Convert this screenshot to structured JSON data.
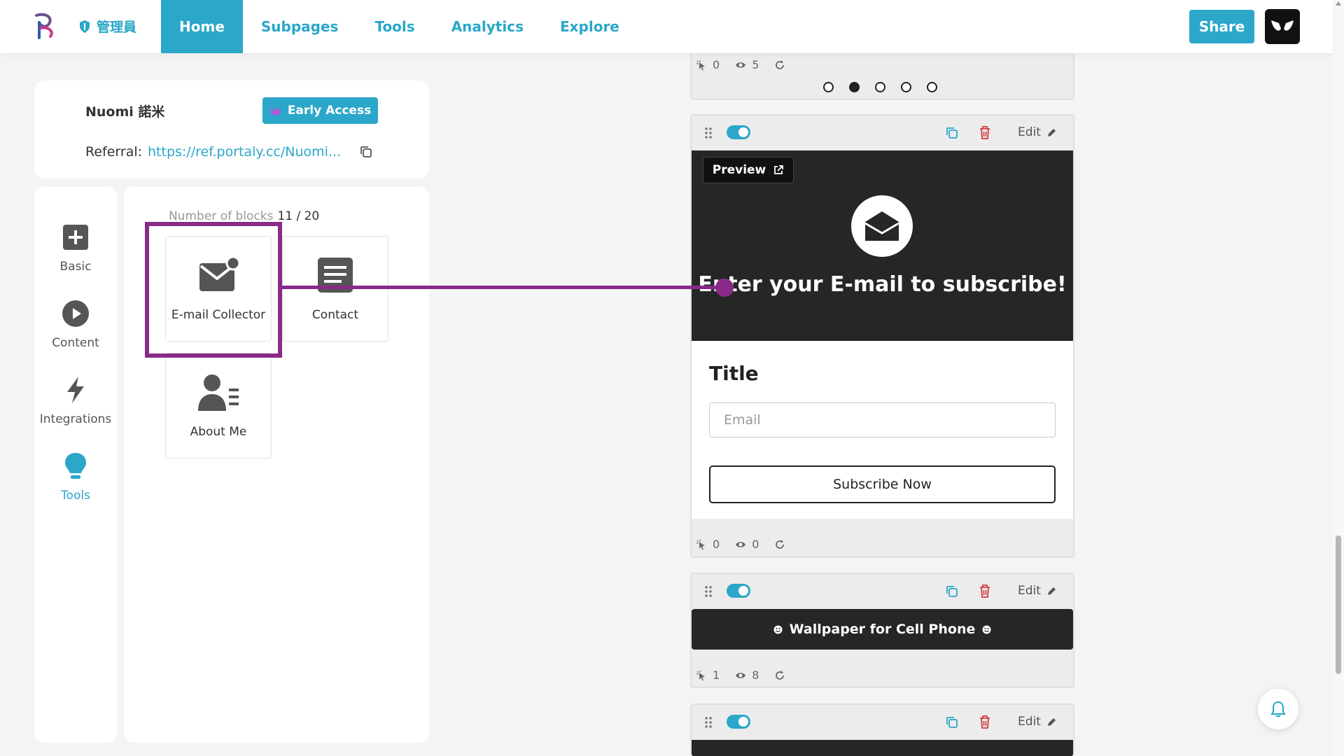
{
  "header": {
    "admin_label": "管理員",
    "nav": [
      {
        "label": "Home",
        "active": true
      },
      {
        "label": "Subpages",
        "active": false
      },
      {
        "label": "Tools",
        "active": false
      },
      {
        "label": "Analytics",
        "active": false
      },
      {
        "label": "Explore",
        "active": false
      }
    ],
    "share_label": "Share"
  },
  "profile": {
    "name": "Nuomi 諾米",
    "early_access_label": "Early Access",
    "referral_label": "Referral:",
    "referral_link": "https://ref.portaly.cc/Nuomi..."
  },
  "categories": [
    {
      "label": "Basic",
      "icon": "plus-square-icon"
    },
    {
      "label": "Content",
      "icon": "play-circle-icon"
    },
    {
      "label": "Integrations",
      "icon": "lightning-icon"
    },
    {
      "label": "Tools",
      "icon": "lightbulb-icon",
      "active": true
    }
  ],
  "blocks": {
    "count_label": "Number of blocks",
    "count_value": "11 / 20",
    "items": [
      {
        "label": "E-mail Collector",
        "icon": "email-collector-icon"
      },
      {
        "label": "Contact",
        "icon": "contact-card-icon"
      },
      {
        "label": "About Me",
        "icon": "about-me-icon"
      }
    ]
  },
  "preview": {
    "top_stats": {
      "clicks": "0",
      "views": "5"
    },
    "carousel_active_index": 1,
    "carousel_count": 5,
    "email_card": {
      "edit_label": "Edit",
      "preview_label": "Preview",
      "hero_text": "Enter your E-mail to subscribe!",
      "title": "Title",
      "email_placeholder": "Email",
      "subscribe_label": "Subscribe Now",
      "stats": {
        "clicks": "0",
        "views": "0"
      }
    },
    "wallpaper_card": {
      "edit_label": "Edit",
      "label": "Wallpaper for Cell Phone",
      "stats": {
        "clicks": "1",
        "views": "8"
      }
    },
    "fourth_card": {
      "edit_label": "Edit"
    }
  },
  "colors": {
    "accent": "#2aa7c9",
    "highlight": "#8a2a88",
    "dark_block": "#262626",
    "delete": "#d03b3b"
  }
}
